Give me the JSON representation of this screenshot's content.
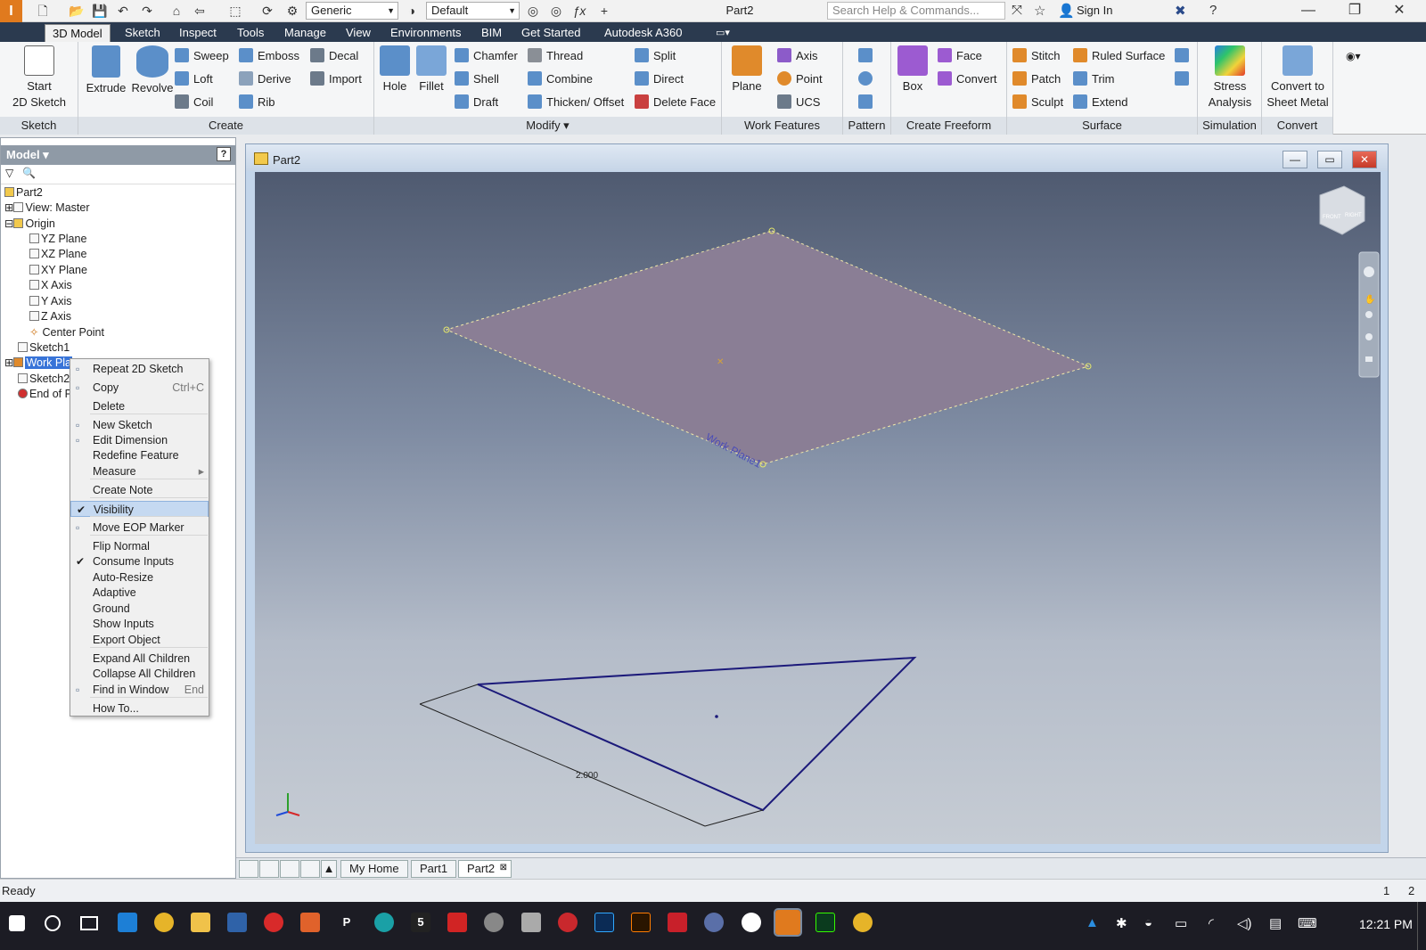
{
  "titlebar": {
    "app_logo": "I",
    "material": "Generic",
    "appearance": "Default",
    "doc_title": "Part2",
    "search_placeholder": "Search Help & Commands...",
    "signin": "Sign In",
    "minimize": "—",
    "restore": "❐",
    "close": "✕"
  },
  "tabs": [
    "3D Model",
    "Sketch",
    "Inspect",
    "Tools",
    "Manage",
    "View",
    "Environments",
    "BIM",
    "Get Started",
    "Autodesk A360"
  ],
  "ribbon": {
    "sketch": {
      "title": "Sketch",
      "start_line1": "Start",
      "start_line2": "2D Sketch"
    },
    "create": {
      "title": "Create",
      "extrude": "Extrude",
      "revolve": "Revolve",
      "sweep": "Sweep",
      "loft": "Loft",
      "coil": "Coil",
      "emboss": "Emboss",
      "derive": "Derive",
      "rib": "Rib",
      "decal": "Decal",
      "import": "Import"
    },
    "modify": {
      "title": "Modify ▾",
      "hole": "Hole",
      "fillet": "Fillet",
      "chamfer": "Chamfer",
      "shell": "Shell",
      "draft": "Draft",
      "thread": "Thread",
      "combine": "Combine",
      "thicken": "Thicken/ Offset",
      "split": "Split",
      "direct": "Direct",
      "delete_face": "Delete Face"
    },
    "work": {
      "title": "Work Features",
      "plane": "Plane",
      "axis": "Axis",
      "point": "Point",
      "ucs": "UCS"
    },
    "pattern": {
      "title": "Pattern"
    },
    "freeform": {
      "title": "Create Freeform",
      "box": "Box",
      "face": "Face",
      "convert": "Convert"
    },
    "surface": {
      "title": "Surface",
      "stitch": "Stitch",
      "patch": "Patch",
      "sculpt": "Sculpt",
      "ruled": "Ruled Surface",
      "trim": "Trim",
      "extend": "Extend"
    },
    "simulation": {
      "title": "Simulation",
      "stress_line1": "Stress",
      "stress_line2": "Analysis"
    },
    "convert": {
      "title": "Convert",
      "sheet_line1": "Convert to",
      "sheet_line2": "Sheet Metal"
    }
  },
  "browser": {
    "header": "Model ▾",
    "help": "?",
    "items": [
      "Part2",
      "View: Master",
      "Origin",
      "YZ Plane",
      "XZ Plane",
      "XY Plane",
      "X Axis",
      "Y Axis",
      "Z Axis",
      "Center Point",
      "Sketch1",
      "Work Pla",
      "Sketch2",
      "End of Pa"
    ]
  },
  "context_menu": {
    "items": [
      {
        "label": "Repeat 2D Sketch",
        "shortcut": ""
      },
      {
        "label": "Copy",
        "shortcut": "Ctrl+C"
      },
      {
        "label": "Delete",
        "shortcut": ""
      },
      {
        "label": "New Sketch",
        "shortcut": ""
      },
      {
        "label": "Edit Dimension",
        "shortcut": ""
      },
      {
        "label": "Redefine Feature",
        "shortcut": ""
      },
      {
        "label": "Measure",
        "shortcut": "▸"
      },
      {
        "label": "Create Note",
        "shortcut": ""
      },
      {
        "label": "Visibility",
        "shortcut": ""
      },
      {
        "label": "Move EOP Marker",
        "shortcut": ""
      },
      {
        "label": "Flip Normal",
        "shortcut": ""
      },
      {
        "label": "Consume Inputs",
        "shortcut": ""
      },
      {
        "label": "Auto-Resize",
        "shortcut": ""
      },
      {
        "label": "Adaptive",
        "shortcut": ""
      },
      {
        "label": "Ground",
        "shortcut": ""
      },
      {
        "label": "Show Inputs",
        "shortcut": ""
      },
      {
        "label": "Export Object",
        "shortcut": ""
      },
      {
        "label": "Expand All Children",
        "shortcut": ""
      },
      {
        "label": "Collapse All Children",
        "shortcut": ""
      },
      {
        "label": "Find in Window",
        "shortcut": "End"
      },
      {
        "label": "How To...",
        "shortcut": ""
      }
    ]
  },
  "document": {
    "name": "Part2",
    "work_plane_label": "Work Plane1",
    "dimension": "2.000",
    "viewcube_front": "FRONT",
    "viewcube_right": "RIGHT"
  },
  "doc_tabs": [
    "My Home",
    "Part1",
    "Part2"
  ],
  "status": {
    "text": "Ready",
    "count1": "1",
    "count2": "2"
  },
  "taskbar": {
    "clock": "12:21 PM"
  },
  "colors": {
    "tab_bar": "#2b3a4f",
    "plane_fill": "#8a7e95",
    "sketch_line": "#1c1a7a",
    "accent_select": "#3874d8"
  }
}
